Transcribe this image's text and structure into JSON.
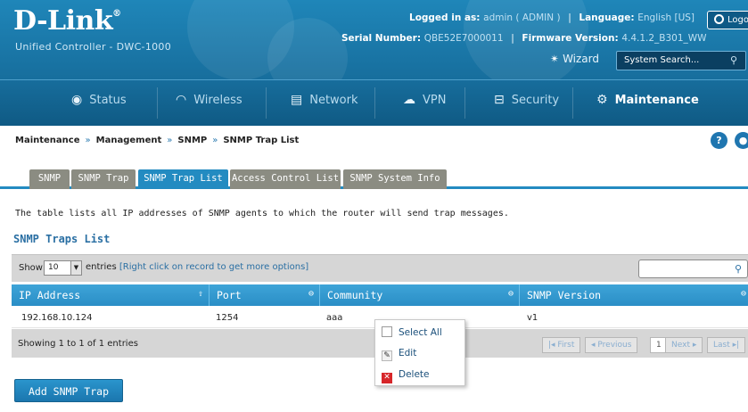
{
  "header": {
    "brand": "D-Link",
    "registered": "®",
    "product": "Unified Controller - DWC-1000",
    "logged_in_label": "Logged in as:",
    "logged_in_value": "admin ( ADMIN )",
    "language_label": "Language:",
    "language_value": "English [US]",
    "serial_label": "Serial Number:",
    "serial_value": "QBE52E7000011",
    "firmware_label": "Firmware Version:",
    "firmware_value": "4.4.1.2_B301_WW",
    "logout_label": "Logout",
    "wizard_label": "Wizard",
    "search_placeholder": "System Search...",
    "colors": {
      "header_bg": "#1f86b9",
      "nav_bg": "#176d9c"
    }
  },
  "nav": [
    {
      "label": "Status",
      "icon": "status-icon"
    },
    {
      "label": "Wireless",
      "icon": "wifi-icon"
    },
    {
      "label": "Network",
      "icon": "network-icon"
    },
    {
      "label": "VPN",
      "icon": "vpn-icon"
    },
    {
      "label": "Security",
      "icon": "lock-icon"
    },
    {
      "label": "Maintenance",
      "icon": "gears-icon",
      "active": true
    }
  ],
  "breadcrumb": [
    "Maintenance",
    "Management",
    "SNMP",
    "SNMP Trap List"
  ],
  "breadcrumb_sep": "»",
  "help_label": "?",
  "tabs": [
    {
      "label": "SNMP"
    },
    {
      "label": "SNMP Trap"
    },
    {
      "label": "SNMP Trap List",
      "active": true
    },
    {
      "label": "Access Control List"
    },
    {
      "label": "SNMP System Info"
    }
  ],
  "description": "The table lists all IP addresses of SNMP agents to which the router will send trap messages.",
  "section_title": "SNMP Traps List",
  "table": {
    "show_label": "Show",
    "entries_value": "10",
    "entries_label": "entries",
    "hint": "[Right click on record to get more options]",
    "columns": [
      "IP Address",
      "Port",
      "Community",
      "SNMP Version"
    ],
    "rows": [
      [
        "192.168.10.124",
        "1254",
        "aaa",
        "v1"
      ]
    ],
    "info": "Showing 1 to 1 of 1 entries",
    "pager": {
      "first": "First",
      "previous": "Previous",
      "page": "1",
      "next": "Next",
      "last": "Last"
    }
  },
  "context_menu": [
    "Select All",
    "Edit",
    "Delete"
  ],
  "add_button_label": "Add SNMP Trap"
}
